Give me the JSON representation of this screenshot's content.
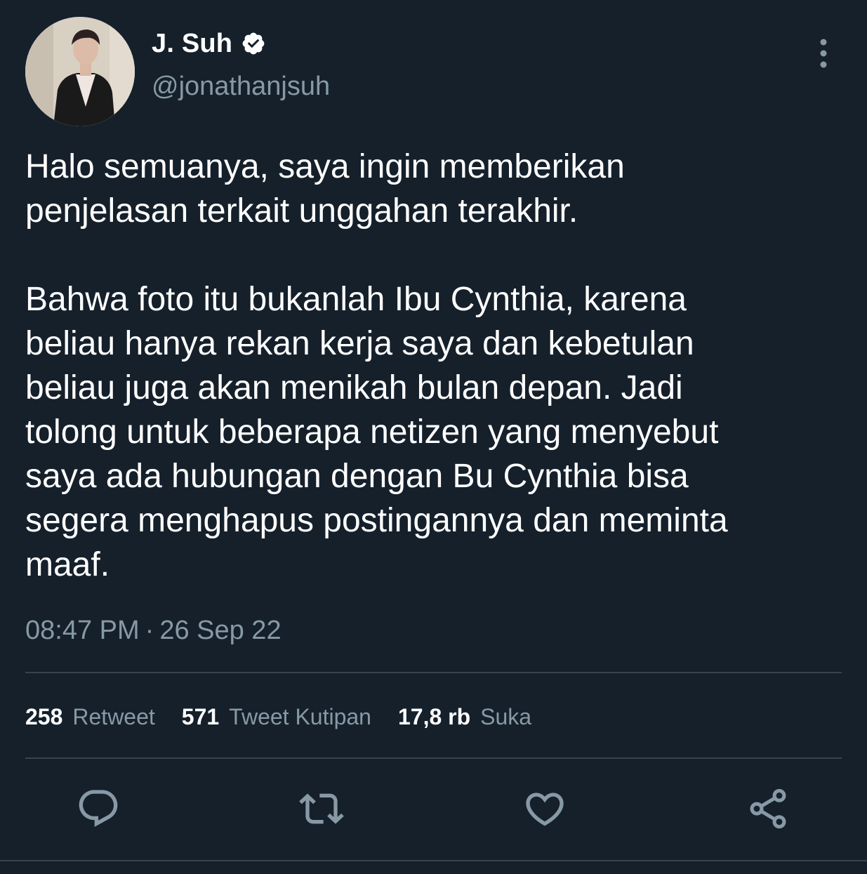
{
  "tweet": {
    "author": {
      "display_name": "J. Suh",
      "handle": "@jonathanjsuh",
      "verified": true
    },
    "body": "Halo semuanya, saya ingin memberikan\npenjelasan terkait unggahan terakhir.\n\nBahwa foto itu bukanlah Ibu Cynthia, karena\nbeliau hanya rekan kerja saya dan kebetulan\nbeliau juga akan menikah bulan depan. Jadi\ntolong untuk beberapa netizen yang menyebut\nsaya ada hubungan dengan Bu Cynthia bisa\nsegera menghapus postingannya dan meminta\nmaaf.",
    "time": "08:47 PM",
    "separator": "·",
    "date": "26 Sep 22",
    "stats": {
      "retweets": {
        "count": "258",
        "label": "Retweet"
      },
      "quotes": {
        "count": "571",
        "label": "Tweet Kutipan"
      },
      "likes": {
        "count": "17,8 rb",
        "label": "Suka"
      }
    },
    "actions": [
      "reply-icon",
      "retweet-icon",
      "like-icon",
      "share-icon"
    ]
  },
  "colors": {
    "background": "#15202b",
    "primary_text": "#ffffff",
    "secondary_text": "#8899a6",
    "divider": "#38444d"
  }
}
